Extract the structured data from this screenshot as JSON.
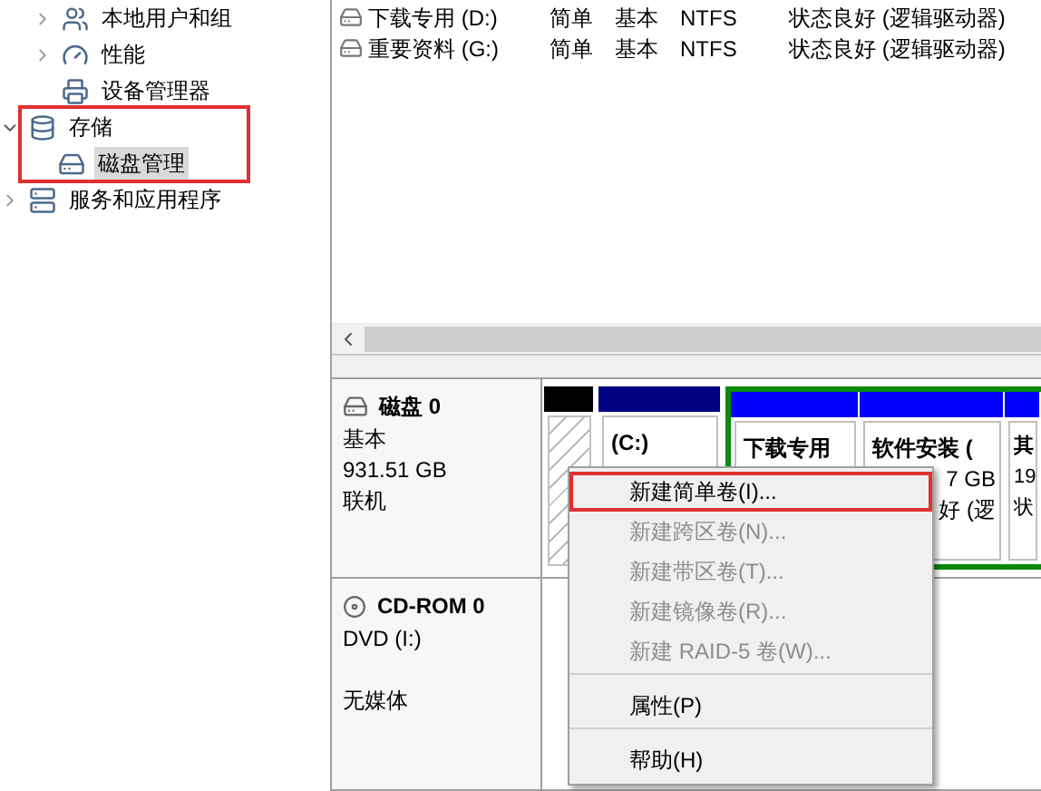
{
  "tree": {
    "branch_children": [
      {
        "label": "本地用户和组",
        "expanded": false
      },
      {
        "label": "性能",
        "expanded": false
      },
      {
        "label": "设备管理器"
      }
    ],
    "items": [
      {
        "label": "存储",
        "expanded": true,
        "marked": true,
        "children": [
          {
            "label": "磁盘管理",
            "selected": true
          }
        ]
      },
      {
        "label": "服务和应用程序",
        "expanded": false,
        "marked": false
      }
    ]
  },
  "volumes": [
    {
      "name": "下载专用 (D:)",
      "layout": "简单",
      "type": "基本",
      "fs": "NTFS",
      "status": "状态良好 (逻辑驱动器)"
    },
    {
      "name": "重要资料 (G:)",
      "layout": "简单",
      "type": "基本",
      "fs": "NTFS",
      "status": "状态良好 (逻辑驱动器)"
    }
  ],
  "disks": [
    {
      "kind": "disk",
      "name": "磁盘 0",
      "lines": [
        "基本",
        "931.51 GB",
        "联机"
      ],
      "partitions": [
        {
          "kind": "unallocated",
          "color": "#000000"
        },
        {
          "kind": "primary",
          "color": "#000080",
          "lines": [
            "(C:)"
          ]
        },
        {
          "kind": "logical",
          "color": "#0000ff",
          "lines": [
            "下载专用"
          ]
        },
        {
          "kind": "logical",
          "color": "#0000ff",
          "lines": [
            "软件安装 (",
            "7 GB",
            "好 (逻"
          ]
        },
        {
          "kind": "logical",
          "color": "#0000ff",
          "lines": [
            "其",
            "19",
            "状"
          ]
        }
      ]
    },
    {
      "kind": "cdrom",
      "name": "CD-ROM 0",
      "lines": [
        "DVD (I:)",
        "无媒体"
      ]
    }
  ],
  "context_menu": [
    {
      "label": "新建简单卷(I)...",
      "disabled": false,
      "separator_before": false,
      "marked": true
    },
    {
      "label": "新建跨区卷(N)...",
      "disabled": true,
      "separator_before": false,
      "marked": false
    },
    {
      "label": "新建带区卷(T)...",
      "disabled": true,
      "separator_before": false,
      "marked": false
    },
    {
      "label": "新建镜像卷(R)...",
      "disabled": true,
      "separator_before": false,
      "marked": false
    },
    {
      "label": "新建 RAID-5 卷(W)...",
      "disabled": true,
      "separator_before": false,
      "marked": false
    },
    {
      "label": "属性(P)",
      "disabled": false,
      "separator_before": true,
      "marked": false
    },
    {
      "label": "帮助(H)",
      "disabled": false,
      "separator_before": true,
      "marked": false
    }
  ]
}
